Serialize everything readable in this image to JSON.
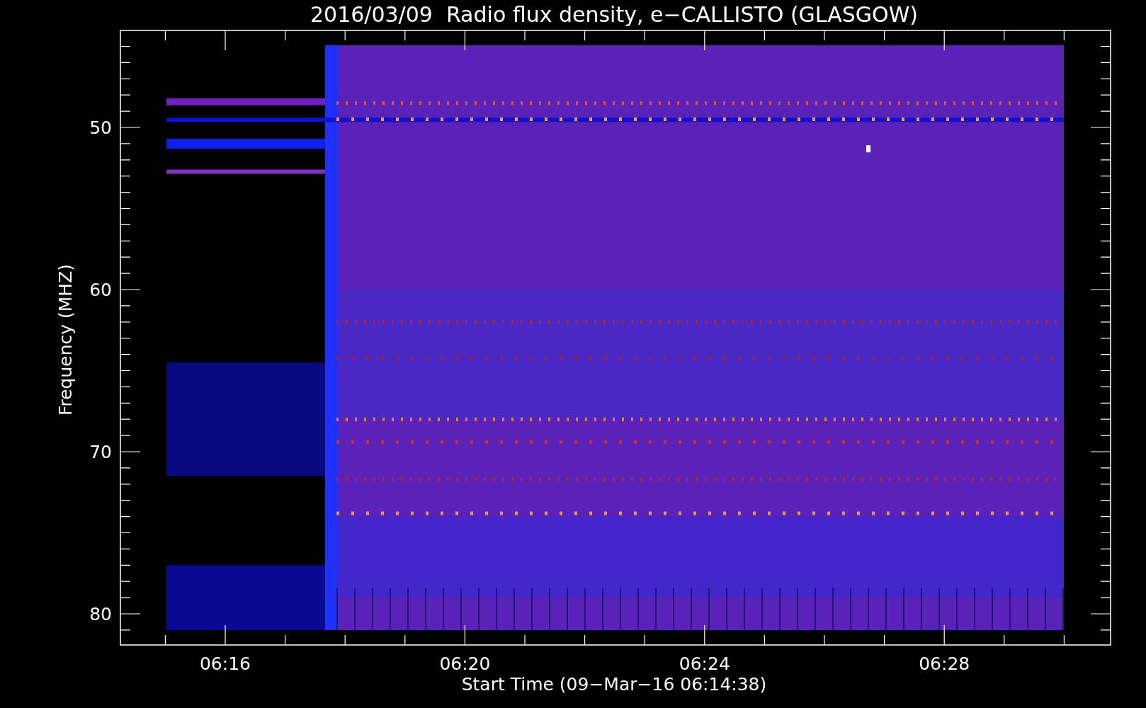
{
  "title": "2016/03/09  Radio flux density, e−CALLISTO (GLASGOW)",
  "y_axis": {
    "label": "Frequency (MHZ)",
    "ticks": [
      "50",
      "60",
      "70",
      "80"
    ]
  },
  "x_axis": {
    "label": "Start Time (09−Mar−16 06:14:38)",
    "ticks": [
      "06:16",
      "06:20",
      "06:24",
      "06:28"
    ]
  }
}
